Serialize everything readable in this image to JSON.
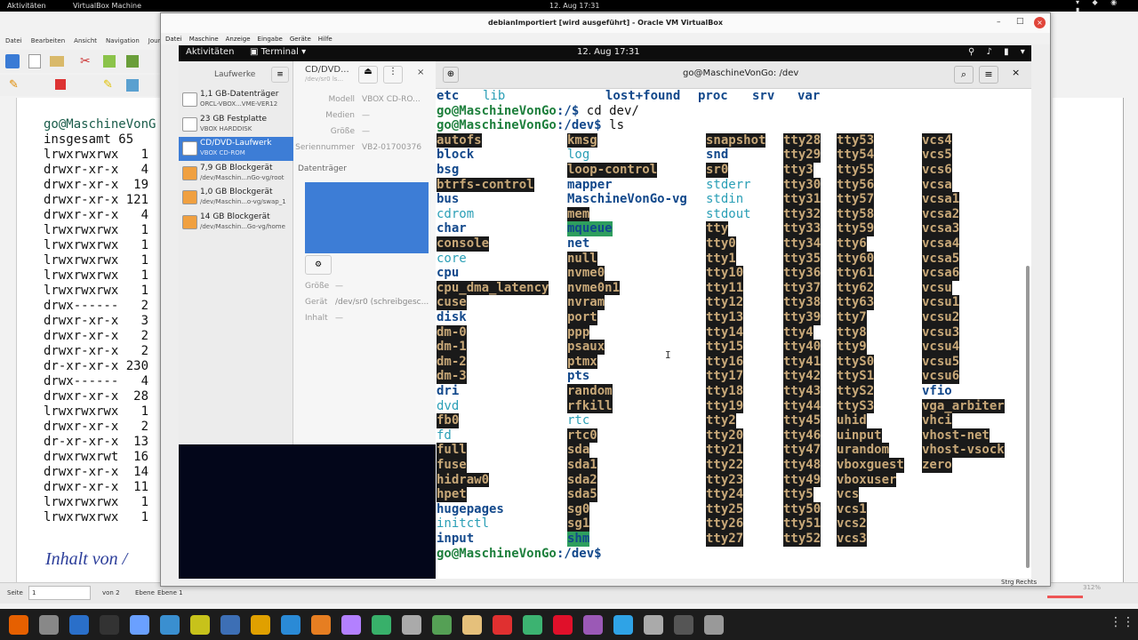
{
  "topbar": {
    "activities": "Aktivitäten",
    "app_menu": "VirtualBox Machine",
    "clock": "12. Aug  17:31"
  },
  "libreoffice": {
    "menu": [
      "Datei",
      "Bearbeiten",
      "Ansicht",
      "Navigation",
      "Journ"
    ],
    "doc_lines": [
      {
        "t": "go@MaschineVonG",
        "c": "t"
      },
      {
        "t": "insgesamt 65"
      },
      {
        "t": "lrwxrwxrwx   1"
      },
      {
        "t": "drwxr-xr-x   4"
      },
      {
        "t": "drwxr-xr-x  19"
      },
      {
        "t": "drwxr-xr-x 121"
      },
      {
        "t": "drwxr-xr-x   4"
      },
      {
        "t": "lrwxrwxrwx   1"
      },
      {
        "t": "lrwxrwxrwx   1"
      },
      {
        "t": "lrwxrwxrwx   1"
      },
      {
        "t": "lrwxrwxrwx   1"
      },
      {
        "t": "lrwxrwxrwx   1"
      },
      {
        "t": "drwx------   2"
      },
      {
        "t": "drwxr-xr-x   3"
      },
      {
        "t": "drwxr-xr-x   2"
      },
      {
        "t": "drwxr-xr-x   2"
      },
      {
        "t": "dr-xr-xr-x 230"
      },
      {
        "t": "drwx------   4"
      },
      {
        "t": "drwxr-xr-x  28"
      },
      {
        "t": "lrwxrwxrwx   1"
      },
      {
        "t": "drwxr-xr-x   2"
      },
      {
        "t": "dr-xr-xr-x  13"
      },
      {
        "t": "drwxrwxrwt  16"
      },
      {
        "t": "drwxr-xr-x  14"
      },
      {
        "t": "drwxr-xr-x  11"
      },
      {
        "t": "lrwxrwxrwx   1"
      },
      {
        "t": "lrwxrwxrwx   1"
      }
    ],
    "caption": "Inhalt von /",
    "status": {
      "page_label": "Seite",
      "page_value": "1",
      "of_label": "von 2",
      "level_label": "Ebene",
      "level_value": "Ebene 1",
      "zoom": "312%"
    }
  },
  "virtualbox": {
    "title": "debianImportiert [wird ausgeführt] - Oracle VM VirtualBox",
    "menu": [
      "Datei",
      "Maschine",
      "Anzeige",
      "Eingabe",
      "Geräte",
      "Hilfe"
    ],
    "hostkey": "Strg Rechts"
  },
  "guest": {
    "activities": "Aktivitäten",
    "app": "Terminal",
    "clock": "12. Aug  17:31"
  },
  "files": {
    "sidebar_title": "Laufwerke",
    "drives": [
      {
        "name": "1,1 GB-Datenträger",
        "sub": "ORCL-VBOX...VME-VER12",
        "color": "#ffffff"
      },
      {
        "name": "23 GB Festplatte",
        "sub": "VBOX HARDDISK",
        "color": "#ffffff"
      },
      {
        "name": "CD/DVD-Laufwerk",
        "sub": "VBOX CD-ROM",
        "color": "#ffffff"
      },
      {
        "name": "7,9 GB Blockgerät",
        "sub": "/dev/Maschin...nGo-vg/root",
        "color": "#f0a040"
      },
      {
        "name": "1,0 GB Blockgerät",
        "sub": "/dev/Maschin...o-vg/swap_1",
        "color": "#f0a040"
      },
      {
        "name": "14 GB Blockgerät",
        "sub": "/dev/Maschin...Go-vg/home",
        "color": "#f0a040"
      }
    ],
    "header_title": "CD/DVD...",
    "header_sub": "/dev/sr0 ls...",
    "props": [
      {
        "k": "Modell",
        "v": "VBOX CD-RO..."
      },
      {
        "k": "Medien",
        "v": "—"
      },
      {
        "k": "Größe",
        "v": "—"
      },
      {
        "k": "Seriennummer",
        "v": "VB2-01700376"
      }
    ],
    "volumes_label": "Datenträger",
    "props2": [
      {
        "k": "Größe",
        "v": "—"
      },
      {
        "k": "Gerät",
        "v": "/dev/sr0 (schreibgesc..."
      },
      {
        "k": "Inhalt",
        "v": "—"
      }
    ]
  },
  "terminal": {
    "title": "go@MaschineVonGo: /dev",
    "top_row": [
      [
        "etc",
        "d"
      ],
      [
        "lib",
        "l"
      ],
      [
        "lost+found",
        "d"
      ],
      [
        "proc",
        "d"
      ],
      [
        "srv",
        "d"
      ],
      [
        "var",
        "d"
      ]
    ],
    "prompt_user": "go@MaschineVonGo",
    "cmd1_path": ":/$ ",
    "cmd1": "cd dev/",
    "cmd2_path": ":/dev$ ",
    "cmd2": "ls",
    "final_path": ":/dev$",
    "columns": [
      [
        [
          "autofs",
          "ch"
        ],
        [
          "block",
          "d"
        ],
        [
          "bsg",
          "d"
        ],
        [
          "btrfs-control",
          "ch"
        ],
        [
          "bus",
          "d"
        ],
        [
          "cdrom",
          "l"
        ],
        [
          "char",
          "d"
        ],
        [
          "console",
          "ch"
        ],
        [
          "core",
          "l"
        ],
        [
          "cpu",
          "d"
        ],
        [
          "cpu_dma_latency",
          "ch"
        ],
        [
          "cuse",
          "ch"
        ],
        [
          "disk",
          "d"
        ],
        [
          "dm-0",
          "b"
        ],
        [
          "dm-1",
          "b"
        ],
        [
          "dm-2",
          "b"
        ],
        [
          "dm-3",
          "b"
        ],
        [
          "dri",
          "d"
        ],
        [
          "dvd",
          "l"
        ],
        [
          "fb0",
          "ch"
        ],
        [
          "fd",
          "l"
        ],
        [
          "full",
          "ch"
        ],
        [
          "fuse",
          "ch"
        ],
        [
          "hidraw0",
          "ch"
        ],
        [
          "hpet",
          "ch"
        ],
        [
          "hugepages",
          "d"
        ],
        [
          "initctl",
          "l"
        ],
        [
          "input",
          "d"
        ]
      ],
      [
        [
          "kmsg",
          "ch"
        ],
        [
          "log",
          "l"
        ],
        [
          "loop-control",
          "ch"
        ],
        [
          "mapper",
          "d"
        ],
        [
          "MaschineVonGo-vg",
          "d"
        ],
        [
          "mem",
          "ch"
        ],
        [
          "mqueue",
          "dr"
        ],
        [
          "net",
          "d"
        ],
        [
          "null",
          "ch"
        ],
        [
          "nvme0",
          "ch"
        ],
        [
          "nvme0n1",
          "b"
        ],
        [
          "nvram",
          "ch"
        ],
        [
          "port",
          "ch"
        ],
        [
          "ppp",
          "ch"
        ],
        [
          "psaux",
          "ch"
        ],
        [
          "ptmx",
          "ch"
        ],
        [
          "pts",
          "d"
        ],
        [
          "random",
          "ch"
        ],
        [
          "rfkill",
          "ch"
        ],
        [
          "rtc",
          "l"
        ],
        [
          "rtc0",
          "ch"
        ],
        [
          "sda",
          "b"
        ],
        [
          "sda1",
          "b"
        ],
        [
          "sda2",
          "b"
        ],
        [
          "sda5",
          "b"
        ],
        [
          "sg0",
          "ch"
        ],
        [
          "sg1",
          "ch"
        ],
        [
          "shm",
          "dr"
        ]
      ],
      [
        [
          "snapshot",
          "ch"
        ],
        [
          "snd",
          "d"
        ],
        [
          "sr0",
          "b"
        ],
        [
          "stderr",
          "l"
        ],
        [
          "stdin",
          "l"
        ],
        [
          "stdout",
          "l"
        ],
        [
          "tty",
          "ch"
        ],
        [
          "tty0",
          "ch"
        ],
        [
          "tty1",
          "ch"
        ],
        [
          "tty10",
          "ch"
        ],
        [
          "tty11",
          "ch"
        ],
        [
          "tty12",
          "ch"
        ],
        [
          "tty13",
          "ch"
        ],
        [
          "tty14",
          "ch"
        ],
        [
          "tty15",
          "ch"
        ],
        [
          "tty16",
          "ch"
        ],
        [
          "tty17",
          "ch"
        ],
        [
          "tty18",
          "ch"
        ],
        [
          "tty19",
          "ch"
        ],
        [
          "tty2",
          "ch"
        ],
        [
          "tty20",
          "ch"
        ],
        [
          "tty21",
          "ch"
        ],
        [
          "tty22",
          "ch"
        ],
        [
          "tty23",
          "ch"
        ],
        [
          "tty24",
          "ch"
        ],
        [
          "tty25",
          "ch"
        ],
        [
          "tty26",
          "ch"
        ],
        [
          "tty27",
          "ch"
        ]
      ],
      [
        [
          "tty28",
          "ch"
        ],
        [
          "tty29",
          "ch"
        ],
        [
          "tty3",
          "ch"
        ],
        [
          "tty30",
          "ch"
        ],
        [
          "tty31",
          "ch"
        ],
        [
          "tty32",
          "ch"
        ],
        [
          "tty33",
          "ch"
        ],
        [
          "tty34",
          "ch"
        ],
        [
          "tty35",
          "ch"
        ],
        [
          "tty36",
          "ch"
        ],
        [
          "tty37",
          "ch"
        ],
        [
          "tty38",
          "ch"
        ],
        [
          "tty39",
          "ch"
        ],
        [
          "tty4",
          "ch"
        ],
        [
          "tty40",
          "ch"
        ],
        [
          "tty41",
          "ch"
        ],
        [
          "tty42",
          "ch"
        ],
        [
          "tty43",
          "ch"
        ],
        [
          "tty44",
          "ch"
        ],
        [
          "tty45",
          "ch"
        ],
        [
          "tty46",
          "ch"
        ],
        [
          "tty47",
          "ch"
        ],
        [
          "tty48",
          "ch"
        ],
        [
          "tty49",
          "ch"
        ],
        [
          "tty5",
          "ch"
        ],
        [
          "tty50",
          "ch"
        ],
        [
          "tty51",
          "ch"
        ],
        [
          "tty52",
          "ch"
        ]
      ],
      [
        [
          "tty53",
          "ch"
        ],
        [
          "tty54",
          "ch"
        ],
        [
          "tty55",
          "ch"
        ],
        [
          "tty56",
          "ch"
        ],
        [
          "tty57",
          "ch"
        ],
        [
          "tty58",
          "ch"
        ],
        [
          "tty59",
          "ch"
        ],
        [
          "tty6",
          "ch"
        ],
        [
          "tty60",
          "ch"
        ],
        [
          "tty61",
          "ch"
        ],
        [
          "tty62",
          "ch"
        ],
        [
          "tty63",
          "ch"
        ],
        [
          "tty7",
          "ch"
        ],
        [
          "tty8",
          "ch"
        ],
        [
          "tty9",
          "ch"
        ],
        [
          "ttyS0",
          "ch"
        ],
        [
          "ttyS1",
          "ch"
        ],
        [
          "ttyS2",
          "ch"
        ],
        [
          "ttyS3",
          "ch"
        ],
        [
          "uhid",
          "ch"
        ],
        [
          "uinput",
          "ch"
        ],
        [
          "urandom",
          "ch"
        ],
        [
          "vboxguest",
          "ch"
        ],
        [
          "vboxuser",
          "ch"
        ],
        [
          "vcs",
          "ch"
        ],
        [
          "vcs1",
          "ch"
        ],
        [
          "vcs2",
          "ch"
        ],
        [
          "vcs3",
          "ch"
        ]
      ],
      [
        [
          "vcs4",
          "ch"
        ],
        [
          "vcs5",
          "ch"
        ],
        [
          "vcs6",
          "ch"
        ],
        [
          "vcsa",
          "ch"
        ],
        [
          "vcsa1",
          "ch"
        ],
        [
          "vcsa2",
          "ch"
        ],
        [
          "vcsa3",
          "ch"
        ],
        [
          "vcsa4",
          "ch"
        ],
        [
          "vcsa5",
          "ch"
        ],
        [
          "vcsa6",
          "ch"
        ],
        [
          "vcsu",
          "ch"
        ],
        [
          "vcsu1",
          "ch"
        ],
        [
          "vcsu2",
          "ch"
        ],
        [
          "vcsu3",
          "ch"
        ],
        [
          "vcsu4",
          "ch"
        ],
        [
          "vcsu5",
          "ch"
        ],
        [
          "vcsu6",
          "ch"
        ],
        [
          "vfio",
          "d"
        ],
        [
          "vga_arbiter",
          "ch"
        ],
        [
          "vhci",
          "ch"
        ],
        [
          "vhost-net",
          "ch"
        ],
        [
          "vhost-vsock",
          "ch"
        ],
        [
          "zero",
          "ch"
        ]
      ]
    ]
  },
  "taskbar": {
    "icons": [
      "firefox-icon",
      "files-icon",
      "writer-icon",
      "terminal-icon",
      "editor-icon",
      "app-icon-1",
      "app-icon-2",
      "network-icon",
      "app-icon-3",
      "vscode-icon",
      "app-icon-4",
      "app-icon-5",
      "app-icon-6",
      "settings-icon",
      "app-icon-7",
      "app-icon-8",
      "filezilla-icon",
      "app-icon-9",
      "opera-icon",
      "virtualbox-icon",
      "app-icon-10",
      "app-icon-11",
      "app-icon-12",
      "app-icon-13",
      "apps-grid-icon"
    ],
    "colors": [
      "#e66000",
      "#888",
      "#2a6fc9",
      "#333",
      "#6aa0ff",
      "#3a8fd0",
      "#c7c21b",
      "#3d6fb5",
      "#e0a000",
      "#2a8ad6",
      "#e67e22",
      "#b380ff",
      "#38b06a",
      "#aaa",
      "#55a055",
      "#e5c07b",
      "#e03030",
      "#3cb371",
      "#e0102a",
      "#9b59b6",
      "#2fa3e6",
      "#aaa",
      "#555",
      "#999",
      "#ddd"
    ]
  }
}
